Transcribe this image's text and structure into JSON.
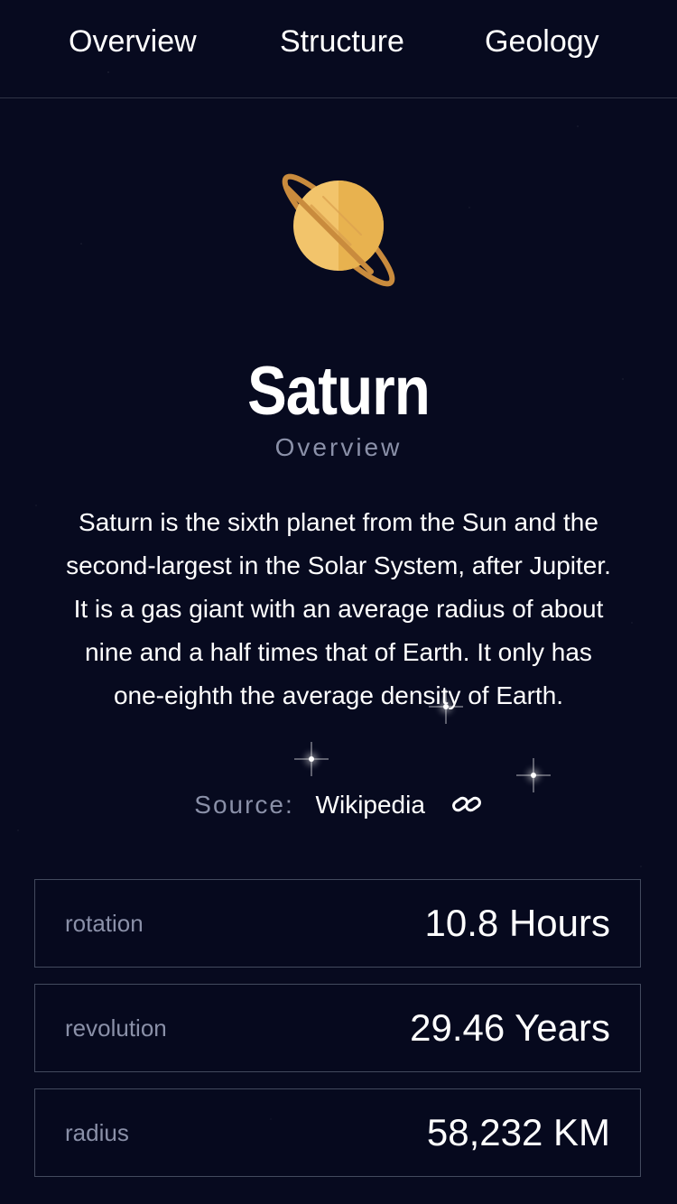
{
  "nav": {
    "tabs": [
      {
        "label": "Overview"
      },
      {
        "label": "Structure"
      },
      {
        "label": "Geology"
      }
    ]
  },
  "planet": {
    "icon": "saturn-icon",
    "name": "Saturn",
    "section": "Overview",
    "description": "Saturn is the sixth planet from the Sun and the second-largest in the Solar System, after Jupiter. It is a gas giant with an average radius of about nine and a half times that of Earth. It only has one-eighth the average density of Earth."
  },
  "source": {
    "label": "Source:",
    "link_text": "Wikipedia",
    "icon": "link-icon"
  },
  "stats": [
    {
      "label": "rotation",
      "value": "10.8 Hours"
    },
    {
      "label": "revolution",
      "value": "29.46 Years"
    },
    {
      "label": "radius",
      "value": "58,232 KM"
    }
  ],
  "colors": {
    "background": "#070a1f",
    "text": "#ffffff",
    "muted_text": "#8a90a8",
    "border": "#434a5e",
    "planet_main": "#f2c46b",
    "planet_shadow": "#e8b24f",
    "ring": "#c98b3d"
  }
}
